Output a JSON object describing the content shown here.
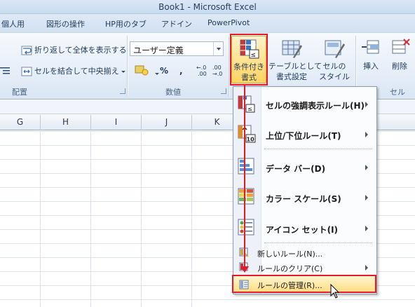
{
  "window": {
    "title": "Book1  -  Microsoft Excel"
  },
  "tabs": [
    {
      "label": "個人用"
    },
    {
      "label": "図形の操作"
    },
    {
      "label": "HP用のタブ"
    },
    {
      "label": "アドイン"
    },
    {
      "label": "PowerPivot"
    }
  ],
  "ribbon": {
    "alignment": {
      "wrap_text": "折り返して全体を表示する",
      "merge_center": "セルを結合して中央揃え",
      "group_label": "配置"
    },
    "number": {
      "format_value": "ユーザー定義",
      "percent": "%",
      "comma": ",",
      "inc_decimal": "←.0\n.00",
      "dec_decimal": ".00\n→.0",
      "group_label": "数値"
    },
    "styles": {
      "conditional_formatting": "条件付き\n書式",
      "format_as_table": "テーブルとして\n書式設定",
      "cell_styles": "セルの\nスタイル"
    },
    "cells": {
      "insert": "挿入",
      "delete": "削除",
      "group_label": "セル"
    }
  },
  "columns": [
    "G",
    "H",
    "I",
    "J",
    "K"
  ],
  "menu": {
    "items": [
      {
        "label": "セルの強調表示ルール(H)",
        "icon": "highlight-rules-icon",
        "submenu": true
      },
      {
        "label": "上位/下位ルール(T)",
        "icon": "top-bottom-rules-icon",
        "submenu": true
      },
      {
        "label": "データ バー(D)",
        "icon": "data-bars-icon",
        "submenu": true
      },
      {
        "label": "カラー スケール(S)",
        "icon": "color-scales-icon",
        "submenu": true
      },
      {
        "label": "アイコン セット(I)",
        "icon": "icon-sets-icon",
        "submenu": true
      }
    ],
    "new_rule": "新しいルール(N)...",
    "clear_rules": "ルールのクリア(C)",
    "manage_rules": "ルールの管理(R)..."
  },
  "colors": {
    "highlight_outline": "#e8182a",
    "active_button": "#ffd35f",
    "ribbon": "#e3ecf7"
  }
}
